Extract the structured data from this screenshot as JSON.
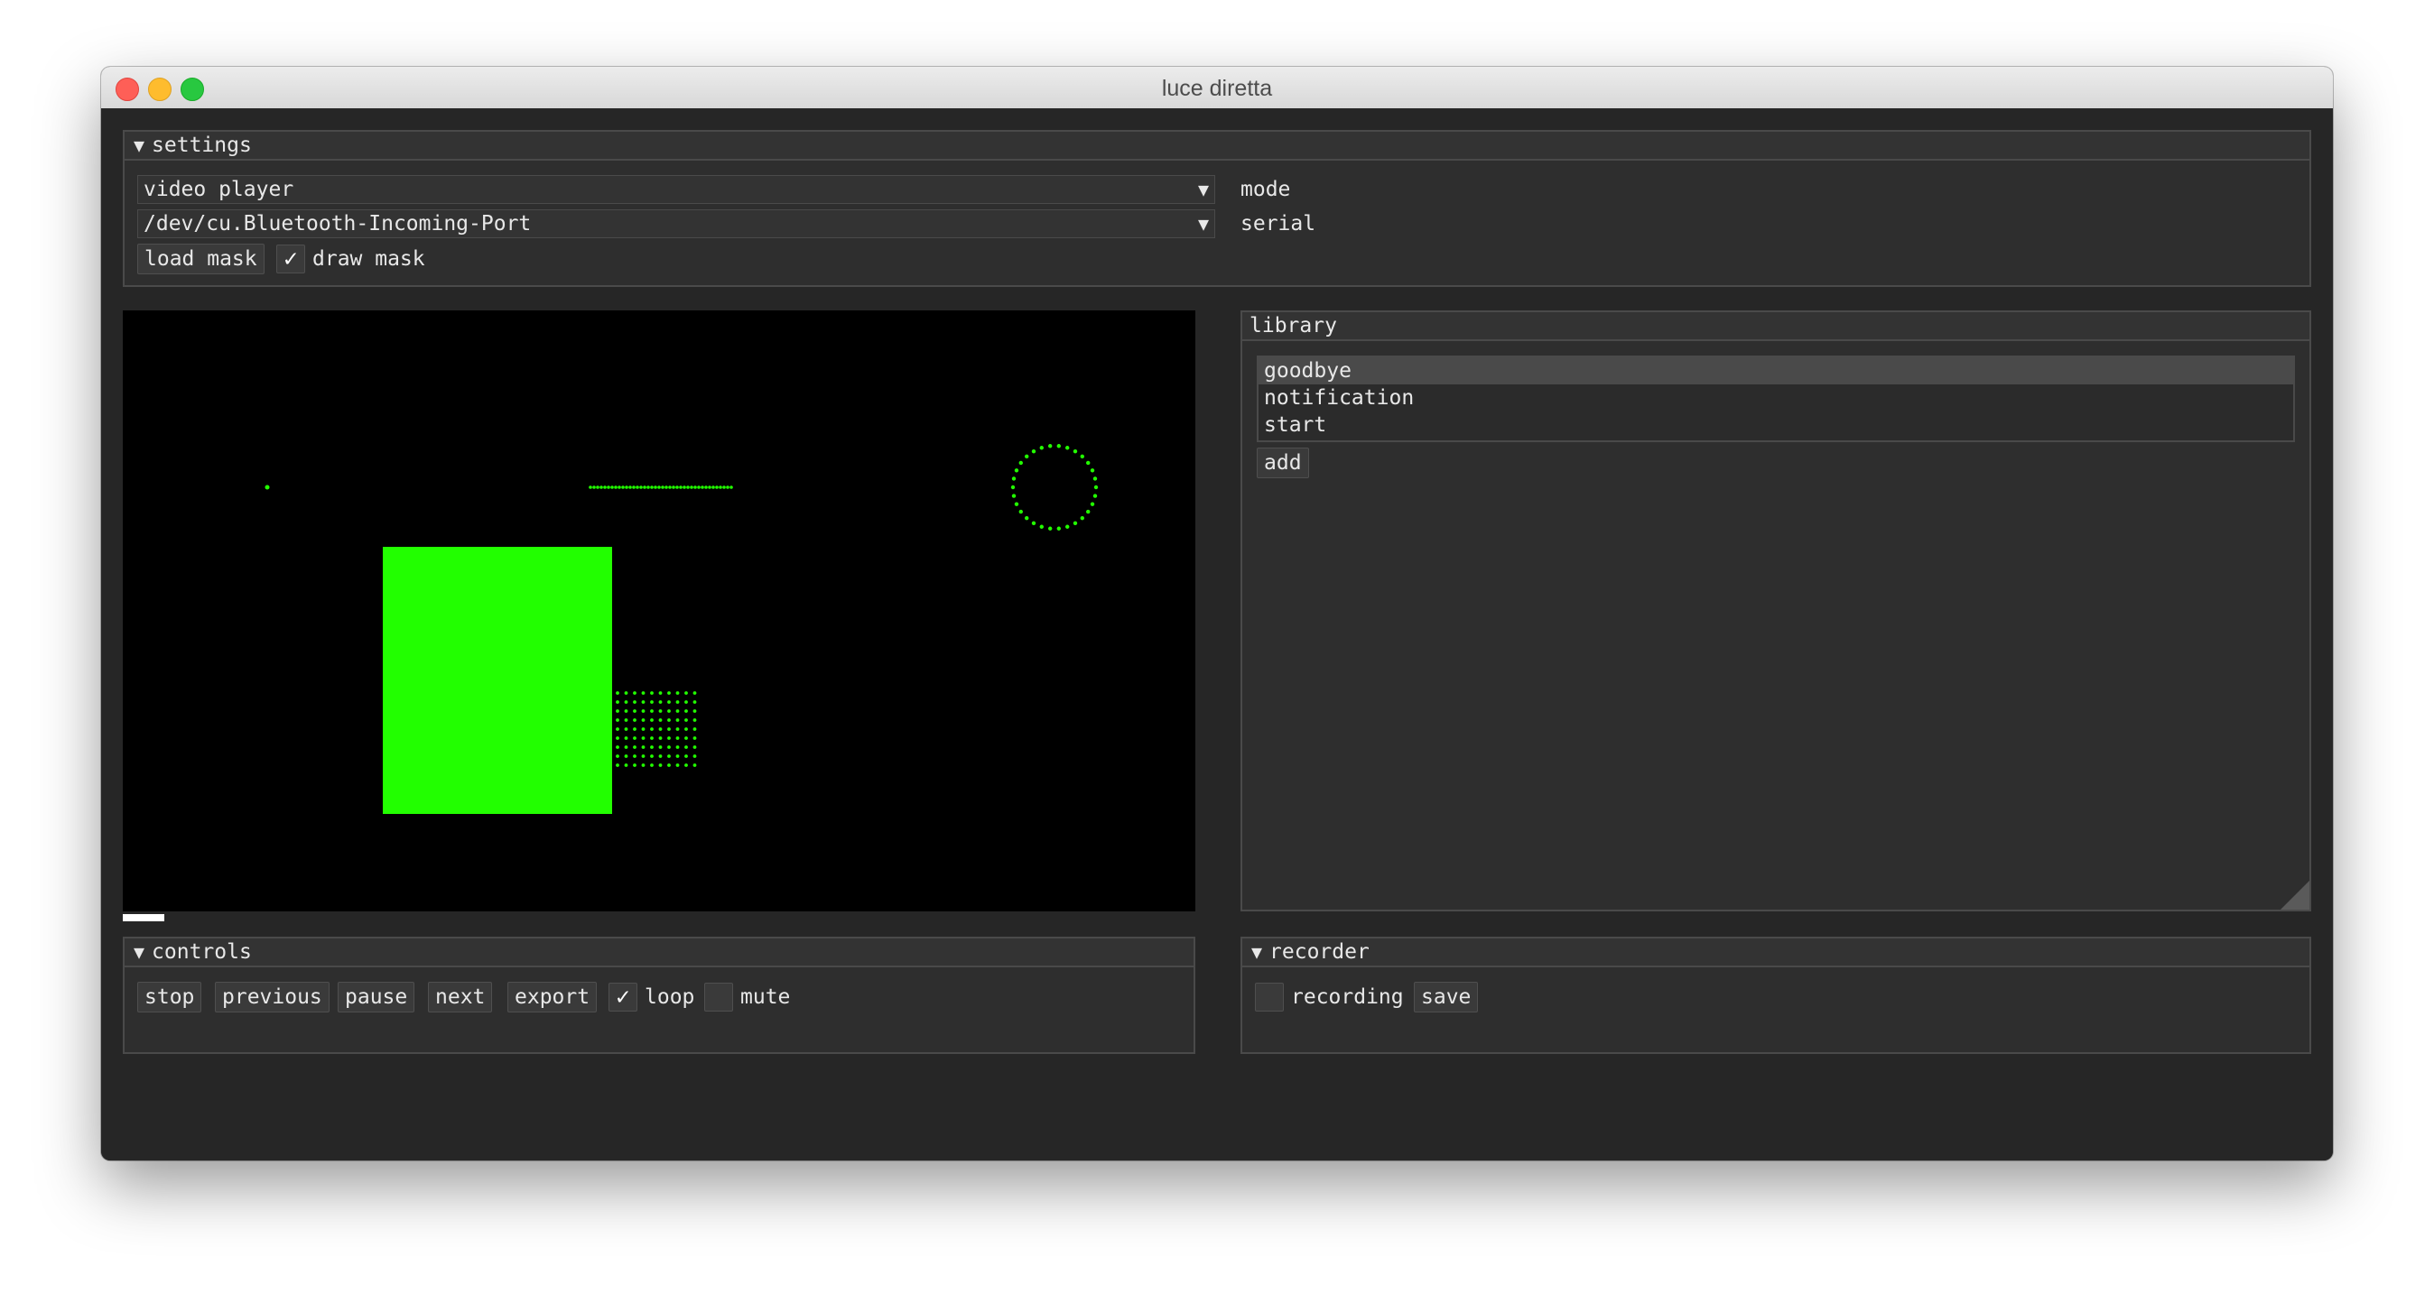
{
  "window": {
    "title": "luce diretta"
  },
  "settings": {
    "header": "settings",
    "mode": {
      "value": "video player",
      "label": "mode"
    },
    "serial": {
      "value": "/dev/cu.Bluetooth-Incoming-Port",
      "label": "serial"
    },
    "load_mask_label": "load mask",
    "draw_mask": {
      "label": "draw mask",
      "checked": true
    }
  },
  "library": {
    "header": "library",
    "items": [
      {
        "label": "goodbye",
        "selected": true
      },
      {
        "label": "notification",
        "selected": false
      },
      {
        "label": "start",
        "selected": false
      }
    ],
    "add_label": "add"
  },
  "controls": {
    "header": "controls",
    "buttons": [
      "stop",
      "previous",
      "pause",
      "next",
      "export"
    ],
    "loop": {
      "label": "loop",
      "checked": true
    },
    "mute": {
      "label": "mute",
      "checked": false
    }
  },
  "recorder": {
    "header": "recorder",
    "recording": {
      "label": "recording",
      "checked": false
    },
    "save_label": "save"
  },
  "preview": {
    "led_color": "#22ff00",
    "background": "#000000"
  },
  "icons": {
    "collapse": "triangle-down-icon",
    "check": "checkmark-icon",
    "dropdown": "dropdown-arrow-icon",
    "resize": "resize-grip-icon"
  }
}
